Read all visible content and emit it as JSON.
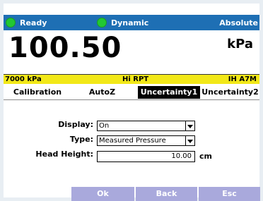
{
  "status": {
    "ready_label": "Ready",
    "dynamic_label": "Dynamic",
    "mode_label": "Absolute",
    "dot_color": "#22c832",
    "bar_color": "#1e6fb4"
  },
  "reading": {
    "value": "100.50",
    "unit": "kPa"
  },
  "info": {
    "range": "7000 kPa",
    "sensor": "Hi RPT",
    "id": "IH A7M",
    "bar_color": "#f2e818"
  },
  "tabs": [
    {
      "label": "Calibration",
      "active": false
    },
    {
      "label": "AutoZ",
      "active": false
    },
    {
      "label": "Uncertainty1",
      "active": true
    },
    {
      "label": "Uncertainty2",
      "active": false
    }
  ],
  "form": {
    "display_label": "Display:",
    "display_value": "On",
    "type_label": "Type:",
    "type_value": "Measured Pressure",
    "head_label": "Head Height:",
    "head_value": "10.00",
    "head_unit": "cm"
  },
  "buttons": {
    "ok": "Ok",
    "back": "Back",
    "esc": "Esc",
    "color": "#a9a9dc"
  }
}
